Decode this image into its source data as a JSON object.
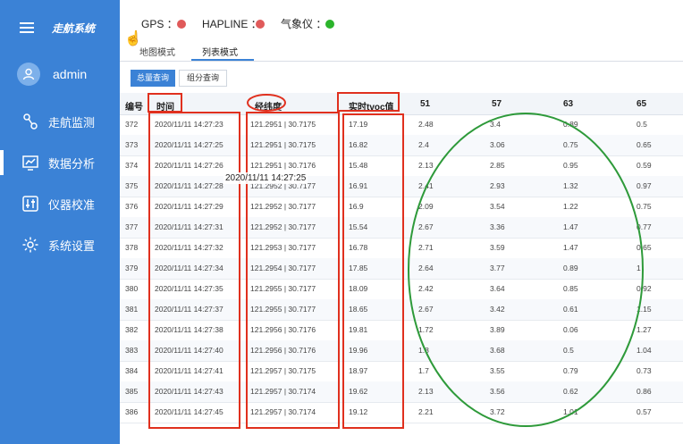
{
  "sidebar": {
    "title": "走航系统",
    "user": "admin",
    "items": [
      {
        "label": "走航监测",
        "icon": "route-icon"
      },
      {
        "label": "数据分析",
        "icon": "chart-icon"
      },
      {
        "label": "仪器校准",
        "icon": "sliders-icon"
      },
      {
        "label": "系统设置",
        "icon": "gear-icon"
      }
    ]
  },
  "status": {
    "gps_label": "GPS ：",
    "hapline_label": "HAPLINE ：",
    "weather_label": "气象仪 ：",
    "gps_color": "#e05a5a",
    "hapline_color": "#e05a5a",
    "weather_color": "#2bb42b"
  },
  "tabs": {
    "map": "地图模式",
    "list": "列表模式"
  },
  "query": {
    "total": "总量查询",
    "group": "组分查询"
  },
  "table": {
    "headers": [
      "编号",
      "时间",
      "经纬度",
      "实时tvoc值",
      "51",
      "57",
      "63",
      "65"
    ],
    "rows": [
      [
        "372",
        "2020/11/11 14:27:23",
        "121.2951 | 30.7175",
        "17.19",
        "2.48",
        "3.4",
        "0.89",
        "0.5"
      ],
      [
        "373",
        "2020/11/11 14:27:25",
        "121.2951 | 30.7175",
        "16.82",
        "2.4",
        "3.06",
        "0.75",
        "0.65"
      ],
      [
        "374",
        "2020/11/11 14:27:26",
        "121.2951 | 30.7176",
        "15.48",
        "2.13",
        "2.85",
        "0.95",
        "0.59"
      ],
      [
        "375",
        "2020/11/11 14:27:28",
        "121.2952 | 30.7177",
        "16.91",
        "2.41",
        "2.93",
        "1.32",
        "0.97"
      ],
      [
        "376",
        "2020/11/11 14:27:29",
        "121.2952 | 30.7177",
        "16.9",
        "2.09",
        "3.54",
        "1.22",
        "0.75"
      ],
      [
        "377",
        "2020/11/11 14:27:31",
        "121.2952 | 30.7177",
        "15.54",
        "2.67",
        "3.36",
        "1.47",
        "0.77"
      ],
      [
        "378",
        "2020/11/11 14:27:32",
        "121.2953 | 30.7177",
        "16.78",
        "2.71",
        "3.59",
        "1.47",
        "0.65"
      ],
      [
        "379",
        "2020/11/11 14:27:34",
        "121.2954 | 30.7177",
        "17.85",
        "2.64",
        "3.77",
        "0.89",
        "1"
      ],
      [
        "380",
        "2020/11/11 14:27:35",
        "121.2955 | 30.7177",
        "18.09",
        "2.42",
        "3.64",
        "0.85",
        "0.92"
      ],
      [
        "381",
        "2020/11/11 14:27:37",
        "121.2955 | 30.7177",
        "18.65",
        "2.67",
        "3.42",
        "0.61",
        "1.15"
      ],
      [
        "382",
        "2020/11/11 14:27:38",
        "121.2956 | 30.7176",
        "19.81",
        "1.72",
        "3.89",
        "0.06",
        "1.27"
      ],
      [
        "383",
        "2020/11/11 14:27:40",
        "121.2956 | 30.7176",
        "19.96",
        "1.8",
        "3.68",
        "0.5",
        "1.04"
      ],
      [
        "384",
        "2020/11/11 14:27:41",
        "121.2957 | 30.7175",
        "18.97",
        "1.7",
        "3.55",
        "0.79",
        "0.73"
      ],
      [
        "385",
        "2020/11/11 14:27:43",
        "121.2957 | 30.7174",
        "19.62",
        "2.13",
        "3.56",
        "0.62",
        "0.86"
      ],
      [
        "386",
        "2020/11/11 14:27:45",
        "121.2957 | 30.7174",
        "19.12",
        "2.21",
        "3.72",
        "1.01",
        "0.57"
      ]
    ]
  },
  "tooltip": "2020/11/11 14:27:25",
  "annotation_colors": {
    "red": "#e0301e",
    "green": "#2e9a3a"
  }
}
